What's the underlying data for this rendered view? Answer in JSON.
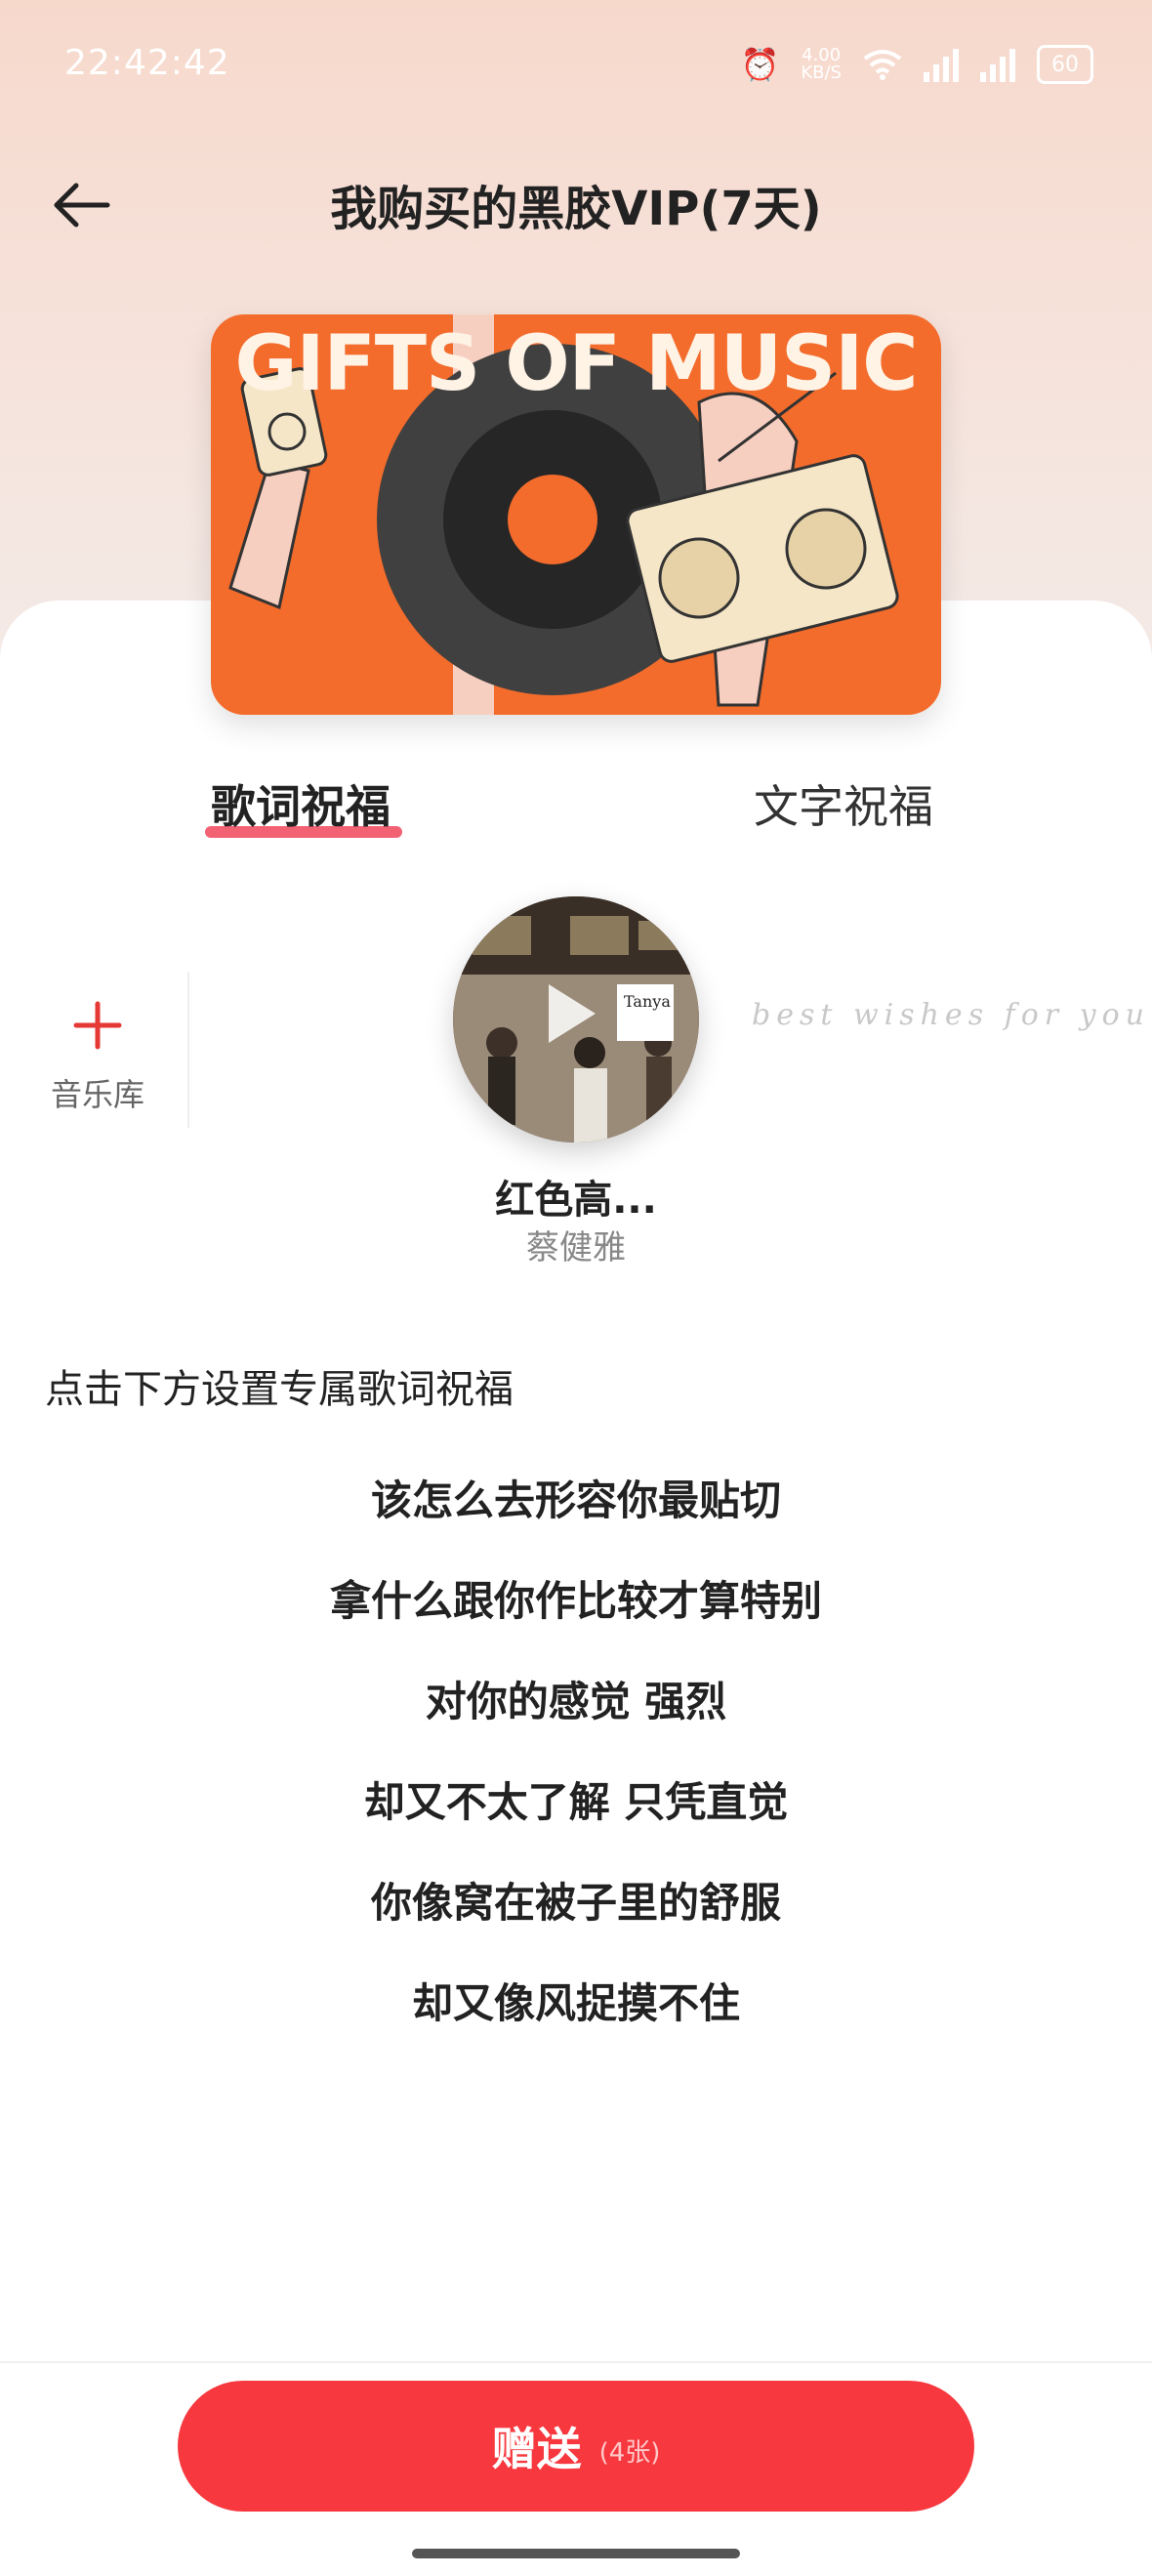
{
  "status_bar": {
    "time": "22:42:42",
    "speed_value": "4.00",
    "speed_unit": "KB/S",
    "battery": "60"
  },
  "header": {
    "title": "我购买的黑胶VIP(7天)"
  },
  "banner": {
    "headline": "GIFTS OF MUSIC",
    "background_color": "#f36c2c"
  },
  "tabs": [
    {
      "label": "歌词祝福",
      "active": true
    },
    {
      "label": "文字祝福",
      "active": false
    }
  ],
  "music_library": {
    "label": "音乐库",
    "icon": "plus-icon"
  },
  "song": {
    "album_text": "Tanya",
    "name": "红色高...",
    "artist": "蔡健雅",
    "decor_text": "best wishes for you"
  },
  "hint": "点击下方设置专属歌词祝福",
  "lyrics": [
    "该怎么去形容你最贴切",
    "拿什么跟你作比较才算特别",
    "对你的感觉 强烈",
    "却又不太了解 只凭直觉",
    "你像窝在被子里的舒服",
    "却又像风捉摸不住"
  ],
  "send_button": {
    "label": "赠送",
    "count": "(4张)",
    "color": "#f7383f"
  }
}
